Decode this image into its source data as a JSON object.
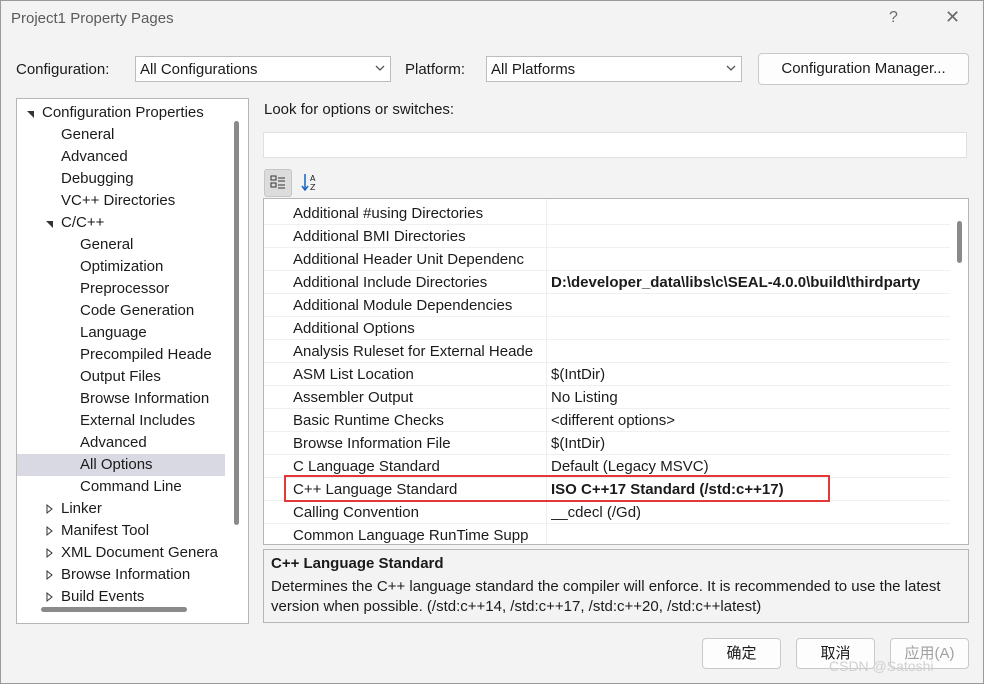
{
  "window": {
    "title": "Project1 Property Pages",
    "help": "?",
    "close": "✕"
  },
  "config": {
    "label": "Configuration:",
    "value": "All Configurations"
  },
  "platform": {
    "label": "Platform:",
    "value": "All Platforms"
  },
  "buttons": {
    "config_manager": "Configuration Manager...",
    "ok": "确定",
    "cancel": "取消",
    "apply": "应用(A)"
  },
  "search": {
    "label": "Look for options or switches:",
    "placeholder": ""
  },
  "tree": {
    "items": [
      {
        "label": "Configuration Properties",
        "expand": "down"
      },
      {
        "label": "General"
      },
      {
        "label": "Advanced"
      },
      {
        "label": "Debugging"
      },
      {
        "label": "VC++ Directories"
      },
      {
        "label": "C/C++",
        "expand": "down"
      },
      {
        "label": "General"
      },
      {
        "label": "Optimization"
      },
      {
        "label": "Preprocessor"
      },
      {
        "label": "Code Generation"
      },
      {
        "label": "Language"
      },
      {
        "label": "Precompiled Heade"
      },
      {
        "label": "Output Files"
      },
      {
        "label": "Browse Information"
      },
      {
        "label": "External Includes"
      },
      {
        "label": "Advanced"
      },
      {
        "label": "All Options",
        "selected": true
      },
      {
        "label": "Command Line"
      },
      {
        "label": "Linker",
        "expand": "right"
      },
      {
        "label": "Manifest Tool",
        "expand": "right"
      },
      {
        "label": "XML Document Genera",
        "expand": "right"
      },
      {
        "label": "Browse Information",
        "expand": "right"
      },
      {
        "label": "Build Events",
        "expand": "right"
      }
    ]
  },
  "grid": {
    "rows": [
      {
        "name": "Additional #using Directories",
        "value": ""
      },
      {
        "name": "Additional BMI Directories",
        "value": ""
      },
      {
        "name": "Additional Header Unit Dependenc",
        "value": ""
      },
      {
        "name": "Additional Include Directories",
        "value": "D:\\developer_data\\libs\\c\\SEAL-4.0.0\\build\\thirdparty",
        "bold": true
      },
      {
        "name": "Additional Module Dependencies",
        "value": ""
      },
      {
        "name": "Additional Options",
        "value": ""
      },
      {
        "name": "Analysis Ruleset for External Heade",
        "value": ""
      },
      {
        "name": "ASM List Location",
        "value": "$(IntDir)"
      },
      {
        "name": "Assembler Output",
        "value": "No Listing"
      },
      {
        "name": "Basic Runtime Checks",
        "value": "<different options>"
      },
      {
        "name": "Browse Information File",
        "value": "$(IntDir)"
      },
      {
        "name": "C Language Standard",
        "value": "Default (Legacy MSVC)"
      },
      {
        "name": "C++ Language Standard",
        "value": "ISO C++17 Standard (/std:c++17)",
        "bold": true
      },
      {
        "name": "Calling Convention",
        "value": "__cdecl (/Gd)"
      },
      {
        "name": "Common Language RunTime Supp",
        "value": ""
      }
    ]
  },
  "description": {
    "title": "C++ Language Standard",
    "text": "Determines the C++ language standard the compiler will enforce. It is recommended to use the latest version when possible. (/std:c++14, /std:c++17, /std:c++20, /std:c++latest)"
  },
  "watermark": "CSDN @Satoshi",
  "colors": {
    "selection": "#d9d9e3",
    "highlight_box": "#e23838"
  },
  "icons": {
    "categorized": "categorized-view-icon",
    "alphabetical": "sort-az-icon"
  }
}
